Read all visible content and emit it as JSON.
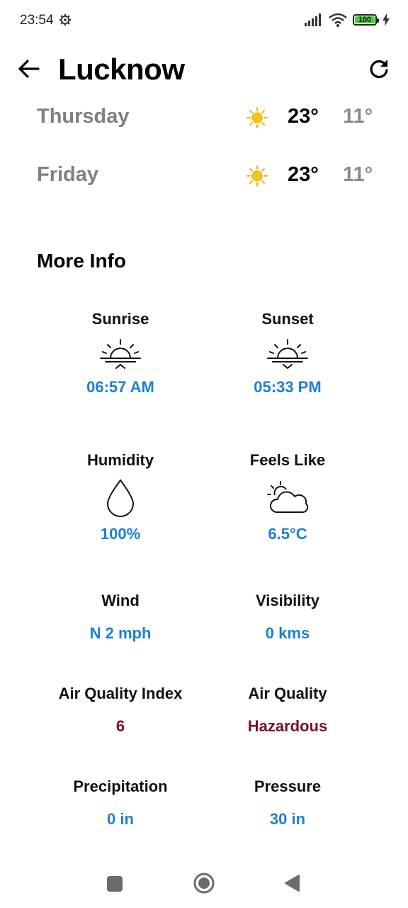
{
  "status": {
    "time": "23:54",
    "battery": "100"
  },
  "header": {
    "title": "Lucknow"
  },
  "forecast": [
    {
      "day": "Thursday",
      "high": "23°",
      "low": "11°",
      "icon": "sunny-icon"
    },
    {
      "day": "Friday",
      "high": "23°",
      "low": "11°",
      "icon": "sunny-icon"
    }
  ],
  "more_info": {
    "title": "More Info",
    "sunrise": {
      "label": "Sunrise",
      "value": "06:57 AM"
    },
    "sunset": {
      "label": "Sunset",
      "value": "05:33 PM"
    },
    "humidity": {
      "label": "Humidity",
      "value": "100%"
    },
    "feels_like": {
      "label": "Feels Like",
      "value": "6.5°C"
    },
    "wind": {
      "label": "Wind",
      "value": "N 2 mph"
    },
    "visibility": {
      "label": "Visibility",
      "value": "0 kms"
    },
    "aqi": {
      "label": "Air Quality Index",
      "value": "6"
    },
    "air_quality": {
      "label": "Air Quality",
      "value": "Hazardous"
    },
    "precipitation": {
      "label": "Precipitation",
      "value": "0 in"
    },
    "pressure": {
      "label": "Pressure",
      "value": "30 in"
    }
  },
  "colors": {
    "value_blue": "#1e7fd8",
    "value_red": "#7a0f2a",
    "sun_yellow": "#f5c518",
    "day_gray": "#808080"
  }
}
